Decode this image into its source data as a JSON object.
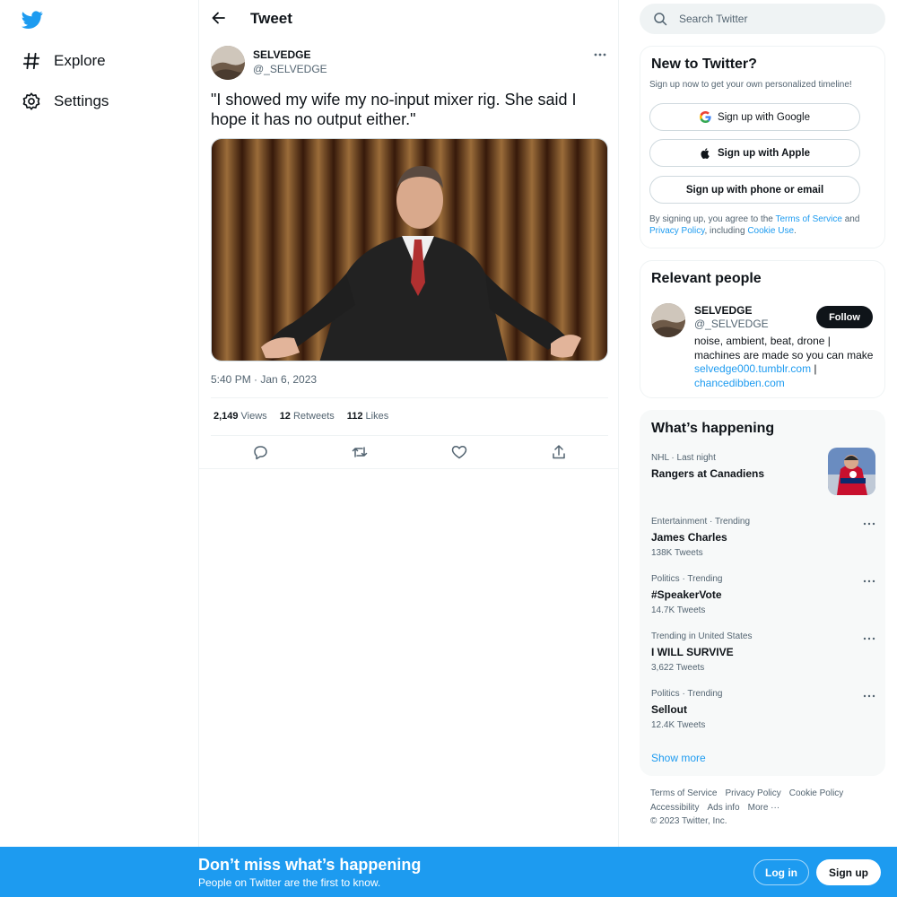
{
  "nav": {
    "logo": "twitter-bird-icon",
    "items": [
      {
        "label": "Explore",
        "icon": "hashtag-icon"
      },
      {
        "label": "Settings",
        "icon": "gear-icon"
      }
    ]
  },
  "header": {
    "title": "Tweet"
  },
  "tweet": {
    "author_name": "SELVEDGE",
    "author_handle": "@_SELVEDGE",
    "text": "\"I showed my wife my no-input mixer rig. She said I hope it has no output either.\"",
    "time": "5:40 PM · Jan 6, 2023",
    "views_count": "2,149",
    "views_label": "Views",
    "retweets_count": "12",
    "retweets_label": "Retweets",
    "likes_count": "112",
    "likes_label": "Likes"
  },
  "search": {
    "placeholder": "Search Twitter"
  },
  "new_to_twitter": {
    "title": "New to Twitter?",
    "subtitle": "Sign up now to get your own personalized timeline!",
    "google_label": "Sign up with Google",
    "apple_label": "Sign up with Apple",
    "phone_label": "Sign up with phone or email",
    "legal_prefix": "By signing up, you agree to the ",
    "terms_link": "Terms of Service",
    "legal_and": " and ",
    "privacy_link": "Privacy Policy",
    "legal_including": ", including ",
    "cookie_link": "Cookie Use",
    "legal_end": "."
  },
  "relevant_people": {
    "title": "Relevant people",
    "name": "SELVEDGE",
    "handle": "@_SELVEDGE",
    "follow_label": "Follow",
    "bio": "noise, ambient, beat, drone | machines are made so you can make",
    "link1": "selvedge000.tumblr.com",
    "separator": " |",
    "link2": "chancedibben.com"
  },
  "whats_happening": {
    "title": "What’s happening",
    "trends": [
      {
        "meta": "NHL · Last night",
        "name": "Rangers at Canadiens",
        "count": ""
      },
      {
        "meta": "Entertainment · Trending",
        "name": "James Charles",
        "count": "138K Tweets"
      },
      {
        "meta": "Politics · Trending",
        "name": "#SpeakerVote",
        "count": "14.7K Tweets"
      },
      {
        "meta": "Trending in United States",
        "name": "I WILL SURVIVE",
        "count": "3,622 Tweets"
      },
      {
        "meta": "Politics · Trending",
        "name": "Sellout",
        "count": "12.4K Tweets"
      }
    ],
    "show_more": "Show more"
  },
  "footer": {
    "links": [
      "Terms of Service",
      "Privacy Policy",
      "Cookie Policy",
      "Accessibility",
      "Ads info",
      "More ···"
    ],
    "copyright": "© 2023 Twitter, Inc."
  },
  "bottom_bar": {
    "title": "Don’t miss what’s happening",
    "subtitle": "People on Twitter are the first to know.",
    "login_label": "Log in",
    "signup_label": "Sign up"
  },
  "colors": {
    "accent": "#1d9bf0",
    "text": "#0f1419",
    "muted": "#536471"
  }
}
